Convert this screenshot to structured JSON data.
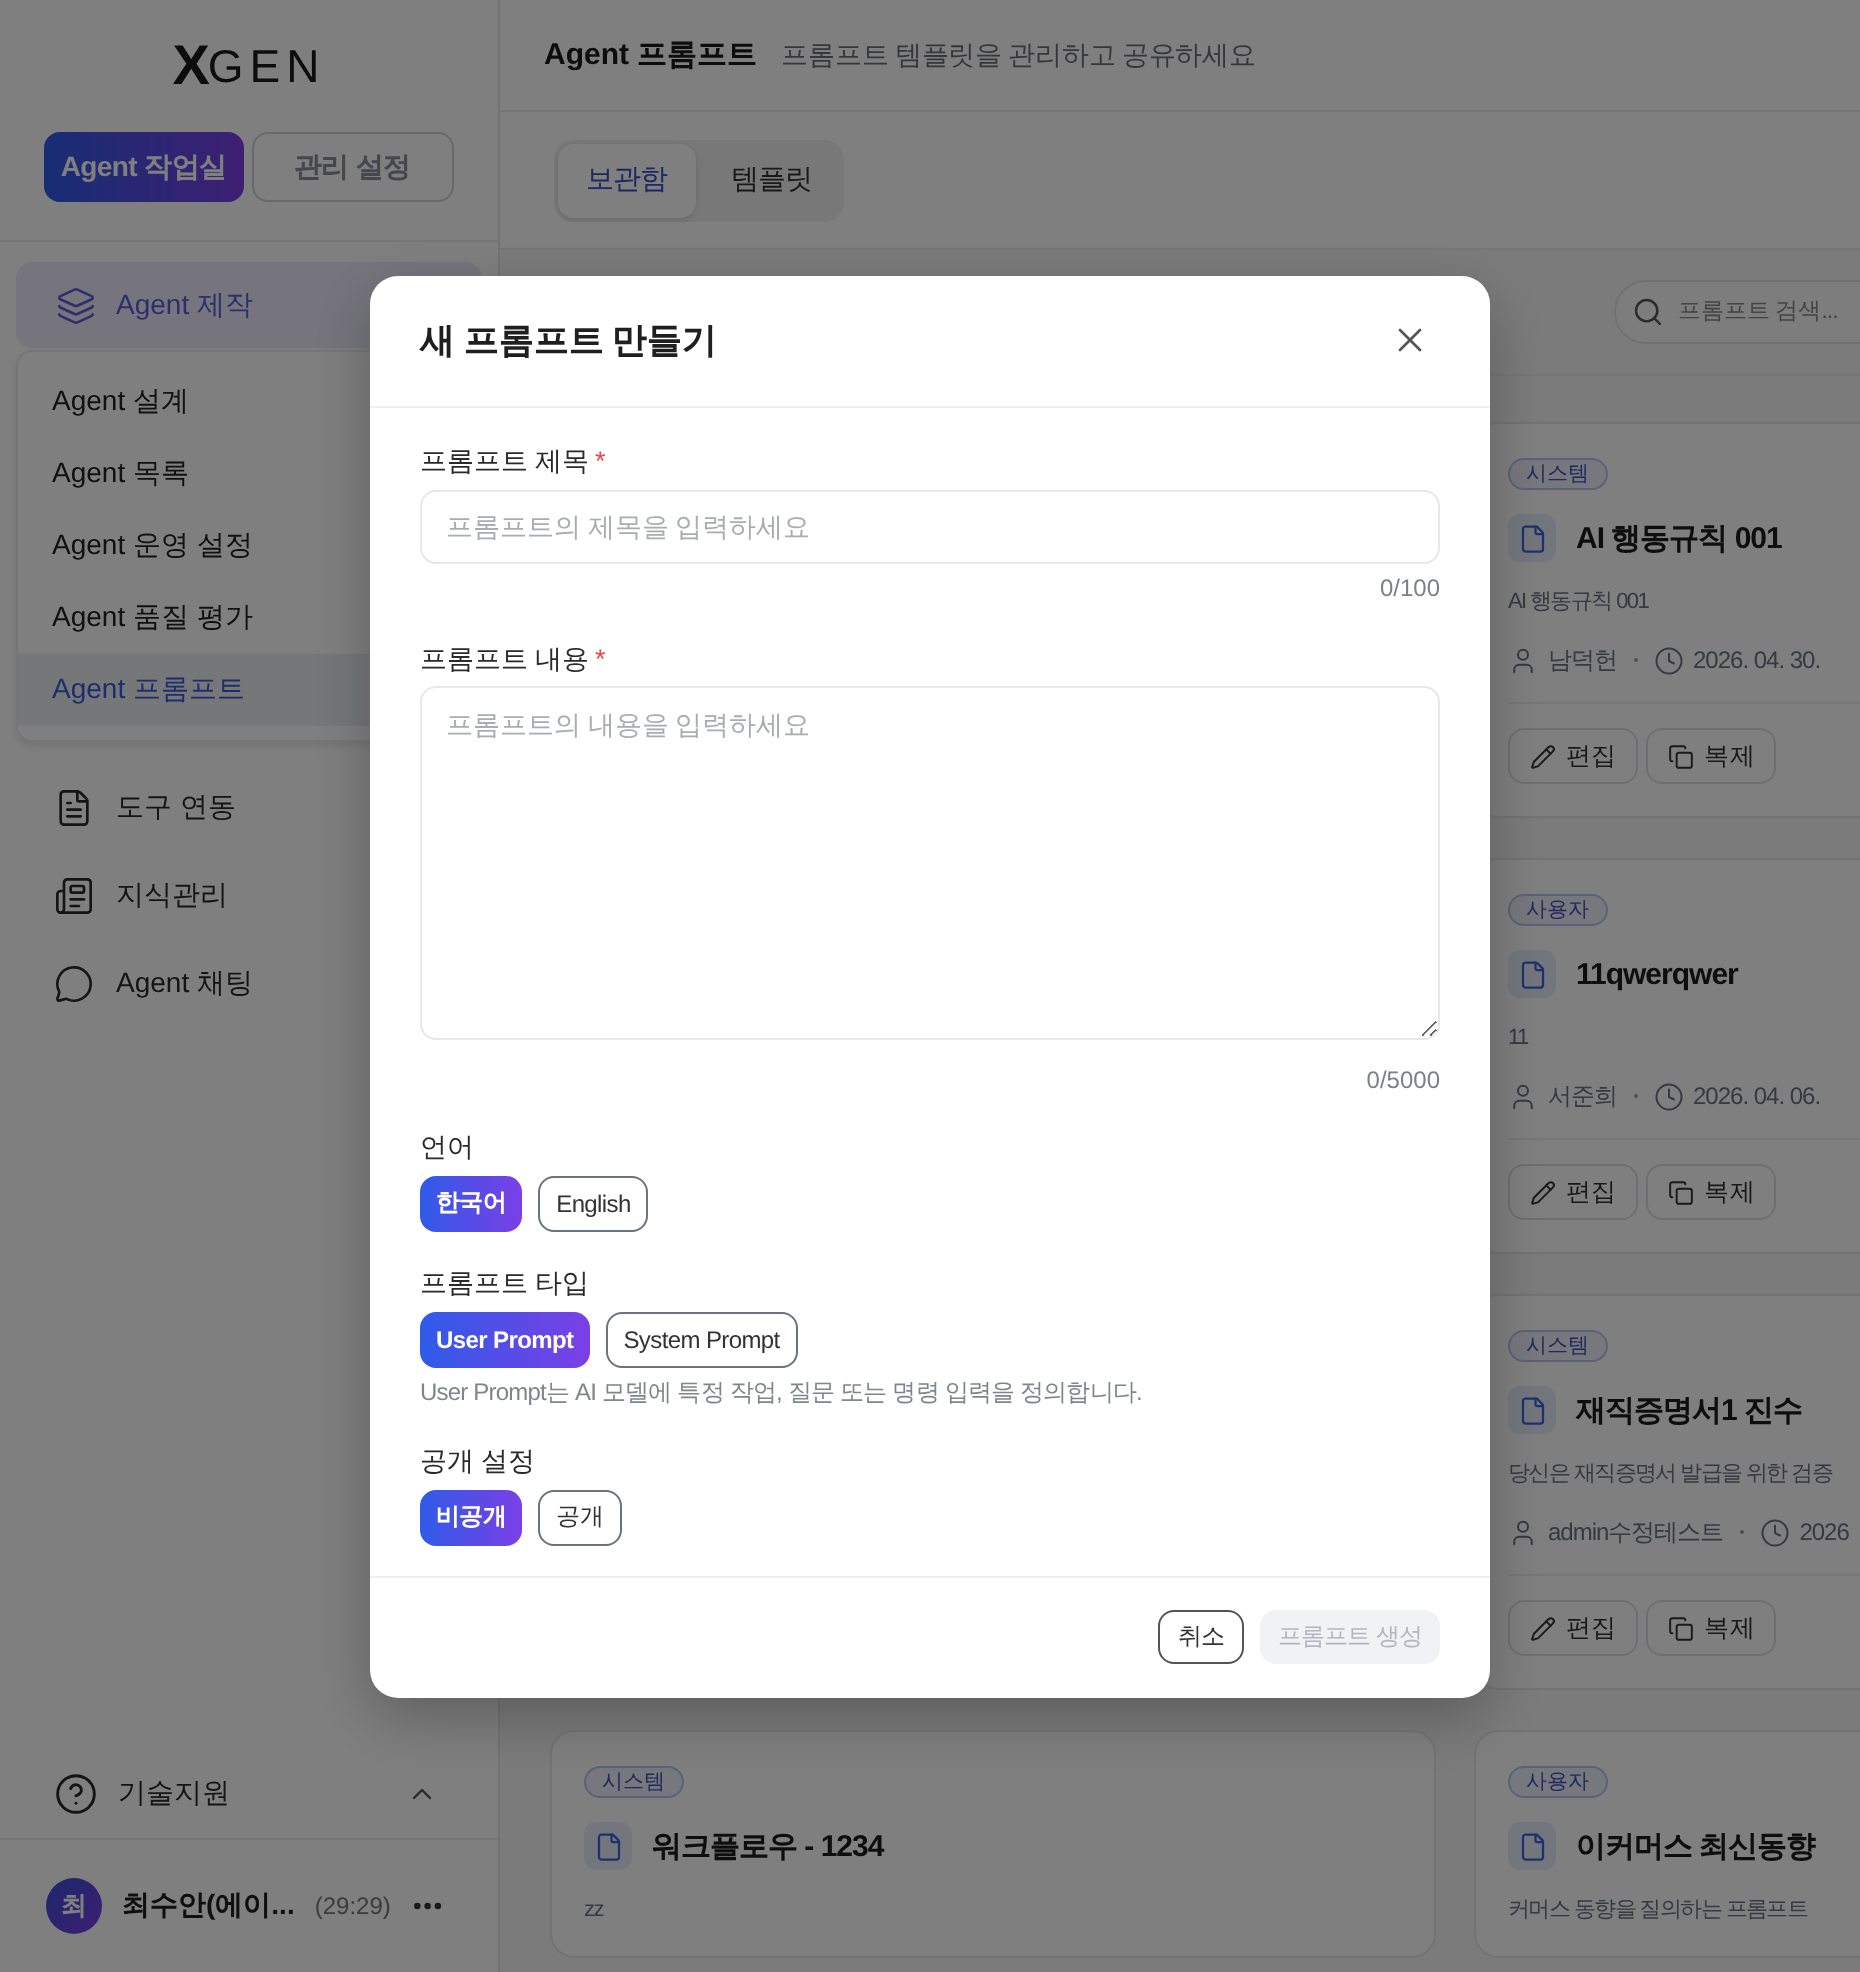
{
  "sidebar": {
    "logo": {
      "mark": "X",
      "text": "GEN"
    },
    "modes": [
      {
        "label": "Agent 작업실",
        "selected": true
      },
      {
        "label": "관리 설정",
        "selected": false
      }
    ],
    "menu_group": {
      "label": "Agent 제작",
      "expanded": true,
      "children": [
        {
          "label": "Agent 설계",
          "selected": false
        },
        {
          "label": "Agent 목록",
          "selected": false
        },
        {
          "label": "Agent 운영 설정",
          "selected": false
        },
        {
          "label": "Agent 품질 평가",
          "selected": false
        },
        {
          "label": "Agent 프롬프트",
          "selected": true
        }
      ]
    },
    "menu_links": [
      {
        "label": "도구 연동"
      },
      {
        "label": "지식관리"
      },
      {
        "label": "Agent 채팅"
      }
    ],
    "support": {
      "label": "기술지원"
    },
    "user": {
      "initial": "최",
      "name": "최수안(에이...",
      "session": "(29:29)"
    }
  },
  "header": {
    "title": "Agent 프롬프트",
    "subtitle": "프롬프트 템플릿을 관리하고 공유하세요"
  },
  "tabs": [
    {
      "label": "보관함",
      "selected": true
    },
    {
      "label": "템플릿",
      "selected": false
    }
  ],
  "search": {
    "placeholder": "프롬프트 검색..."
  },
  "cards": [
    {
      "tag": "시스템",
      "title": "AI 행동규칙 001",
      "description": "AI 행동규칙 001",
      "author": "남덕헌",
      "date": "2026. 04. 30.",
      "actions": [
        "편집",
        "복제"
      ]
    },
    {
      "tag": "사용자",
      "title": "11qwerqwer",
      "description": "11",
      "author": "서준희",
      "date": "2026. 04. 06.",
      "actions": [
        "편집",
        "복제"
      ]
    },
    {
      "tag": "시스템",
      "title": "재직증명서1 진수",
      "description": "당신은 재직증명서 발급을 위한 검증",
      "author": "admin수정테스트",
      "date": "2026",
      "actions": [
        "편집",
        "복제"
      ]
    },
    {
      "tag": "시스템",
      "title": "워크플로우 - 1234",
      "description": "zz"
    },
    {
      "tag": "사용자",
      "title": "이커머스 최신동향",
      "description": "커머스 동향을 질의하는 프롬프트"
    }
  ],
  "modal": {
    "title": "새 프롬프트 만들기",
    "fields": [
      {
        "kind": "input",
        "label": "프롬프트 제목",
        "required_mark": "*",
        "placeholder": "프롬프트의 제목을 입력하세요",
        "counter": "0/100"
      },
      {
        "kind": "textarea",
        "label": "프롬프트 내용",
        "required_mark": "*",
        "placeholder": "프롬프트의 내용을 입력하세요",
        "counter": "0/5000"
      }
    ],
    "choices": [
      {
        "label": "언어",
        "options": [
          {
            "label": "한국어",
            "selected": true
          },
          {
            "label": "English",
            "selected": false
          }
        ]
      },
      {
        "label": "프롬프트 타입",
        "options": [
          {
            "label": "User Prompt",
            "selected": true
          },
          {
            "label": "System Prompt",
            "selected": false
          }
        ],
        "hint": "User Prompt는 AI 모델에 특정 작업, 질문 또는 명령 입력을 정의합니다."
      },
      {
        "label": "공개 설정",
        "options": [
          {
            "label": "비공개",
            "selected": true
          },
          {
            "label": "공개",
            "selected": false
          }
        ]
      }
    ],
    "buttons": [
      {
        "label": "취소",
        "kind": "secondary",
        "disabled": false
      },
      {
        "label": "프롬프트 생성",
        "kind": "primary",
        "disabled": true
      }
    ]
  }
}
